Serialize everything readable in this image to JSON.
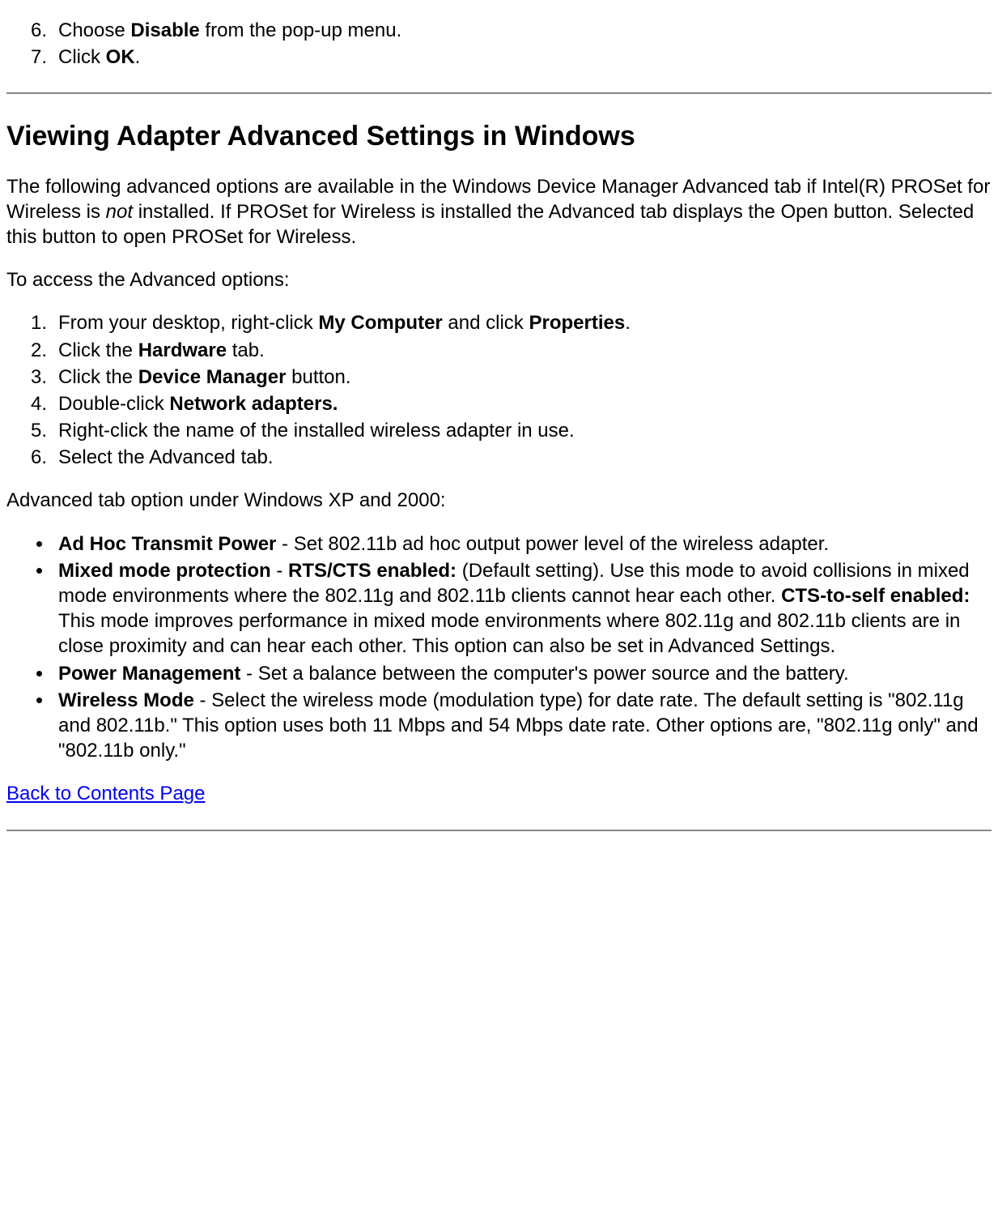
{
  "topList": {
    "item6_pre": "Choose ",
    "item6_bold": "Disable",
    "item6_post": " from the pop-up menu.",
    "item7_pre": "Click ",
    "item7_bold": "OK",
    "item7_post": "."
  },
  "heading": "Viewing Adapter Advanced Settings in Windows",
  "para1_a": "The following advanced options are available in the Windows Device Manager Advanced tab if Intel(R) PROSet for Wireless is ",
  "para1_i": "not",
  "para1_b": " installed. If PROSet for Wireless is installed the Advanced tab displays the Open button. Selected this button to open PROSet for Wireless.",
  "para2": "To access the Advanced options:",
  "steps": {
    "s1_a": "From your desktop, right-click ",
    "s1_b1": "My Computer",
    "s1_mid": " and click ",
    "s1_b2": "Properties",
    "s1_post": ".",
    "s2_a": "Click the ",
    "s2_b": "Hardware",
    "s2_post": " tab.",
    "s3_a": "Click the ",
    "s3_b": "Device Manager",
    "s3_post": " button.",
    "s4_a": "Double-click ",
    "s4_b": "Network adapters.",
    "s5": "Right-click the name of the installed wireless adapter in use.",
    "s6": "Select the Advanced tab."
  },
  "para3": "Advanced tab option under Windows XP and 2000:",
  "bullets": {
    "b1_bold": "Ad Hoc Transmit Power",
    "b1_rest": " - Set 802.11b ad hoc output power level of the wireless adapter.",
    "b2_bold1": "Mixed mode protection",
    "b2_mid1": " - ",
    "b2_bold2": "RTS/CTS enabled:",
    "b2_mid2": " (Default setting). Use this mode to avoid collisions in mixed mode environments where the 802.11g and 802.11b clients cannot hear each other. ",
    "b2_bold3": "CTS-to-self enabled:",
    "b2_rest": " This mode improves performance in mixed mode environments where 802.11g and 802.11b clients are in close proximity and can hear each other. This option can also be set in Advanced Settings.",
    "b3_bold": "Power Management",
    "b3_rest": " - Set a balance between the computer's power source and the battery.",
    "b4_bold": "Wireless Mode",
    "b4_rest": " - Select the wireless mode (modulation type) for date rate. The default setting is \"802.11g and 802.11b.\" This option uses both 11 Mbps and 54 Mbps date rate. Other options are, \"802.11g only\" and \"802.11b only.\""
  },
  "backlink": "Back to Contents Page"
}
